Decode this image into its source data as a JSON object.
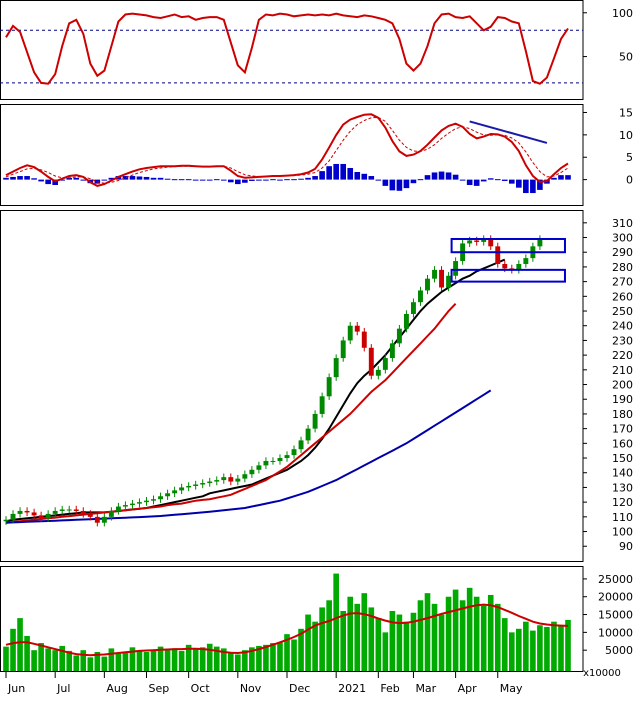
{
  "chart_data": [
    {
      "type": "line",
      "panel": "stochastic",
      "ylim": [
        5,
        110
      ],
      "yticks": [
        100,
        50
      ],
      "reference_lines": [
        80,
        20
      ],
      "colors": {
        "main": "#cc0000",
        "ref": "#000080"
      },
      "series": [
        {
          "values": [
            72,
            85,
            78,
            55,
            32,
            20,
            19,
            30,
            62,
            88,
            92,
            76,
            42,
            28,
            34,
            62,
            90,
            98,
            99,
            98,
            97,
            95,
            94,
            96,
            98,
            95,
            96,
            92,
            94,
            95,
            95,
            92,
            66,
            40,
            32,
            60,
            92,
            98,
            97,
            99,
            98,
            96,
            97,
            98,
            97,
            98,
            97,
            99,
            97,
            96,
            95,
            97,
            96,
            94,
            92,
            88,
            70,
            42,
            34,
            42,
            62,
            88,
            98,
            99,
            95,
            94,
            96,
            88,
            80,
            84,
            95,
            94,
            90,
            88,
            56,
            22,
            19,
            26,
            48,
            70,
            82
          ]
        }
      ]
    },
    {
      "type": "line",
      "panel": "macd",
      "ylim": [
        -5,
        16
      ],
      "yticks": [
        15,
        10,
        5,
        0
      ],
      "colors": {
        "macd": "#cc0000",
        "signal": "#cc0000",
        "hist": "#0000cc",
        "trend": "#1a1aaa"
      },
      "trendline": {
        "from": [
          66,
          13.0
        ],
        "to": [
          77,
          8.2
        ]
      },
      "series": [
        {
          "name": "macd",
          "values": [
            1,
            1.8,
            2.6,
            3.2,
            2.8,
            1.8,
            0.6,
            -0.4,
            0.2,
            0.8,
            1.0,
            0.6,
            -0.6,
            -1.4,
            -1.0,
            -0.2,
            0.6,
            1.2,
            1.8,
            2.3,
            2.6,
            2.8,
            3.0,
            3.0,
            3.0,
            3.1,
            3.1,
            3.0,
            2.9,
            2.9,
            3.0,
            3.0,
            2.0,
            0.8,
            0.4,
            0.5,
            0.6,
            0.7,
            0.8,
            0.8,
            0.9,
            1.0,
            1.2,
            1.6,
            2.4,
            4.5,
            7.2,
            10.0,
            12.3,
            13.4,
            14.0,
            14.5,
            14.6,
            13.8,
            11.6,
            8.6,
            6.3,
            5.3,
            5.6,
            6.4,
            7.8,
            9.4,
            11.0,
            12.0,
            12.5,
            11.8,
            10.2,
            9.2,
            9.6,
            10.2,
            10.1,
            9.6,
            8.4,
            6.4,
            3.2,
            0.8,
            -0.5,
            -0.3,
            1.2,
            2.6,
            3.6
          ]
        },
        {
          "name": "signal",
          "values": [
            0.6,
            1.2,
            1.8,
            2.4,
            2.5,
            2.2,
            1.6,
            0.8,
            0.4,
            0.4,
            0.6,
            0.6,
            0.2,
            -0.5,
            -0.8,
            -0.6,
            -0.2,
            0.4,
            1.0,
            1.6,
            2.0,
            2.4,
            2.6,
            2.8,
            2.9,
            3.0,
            3.0,
            3.0,
            3.0,
            2.9,
            2.9,
            3.0,
            2.6,
            1.8,
            1.1,
            0.8,
            0.7,
            0.7,
            0.7,
            0.8,
            0.8,
            0.9,
            1.0,
            1.2,
            1.6,
            2.6,
            4.2,
            6.5,
            8.8,
            10.8,
            12.3,
            13.2,
            13.8,
            13.9,
            13.0,
            11.0,
            8.8,
            7.2,
            6.4,
            6.3,
            6.8,
            7.8,
            9.2,
            10.4,
            11.4,
            11.8,
            11.4,
            10.6,
            10.0,
            9.9,
            10.0,
            9.9,
            9.3,
            8.2,
            6.2,
            3.8,
            1.8,
            0.6,
            0.8,
            1.6,
            2.6
          ]
        },
        {
          "name": "histogram",
          "values": [
            0.4,
            0.6,
            0.8,
            0.8,
            0.3,
            -0.4,
            -1.0,
            -1.2,
            -0.2,
            0.4,
            0.4,
            0.0,
            -0.8,
            -0.9,
            -0.2,
            0.4,
            0.8,
            0.8,
            0.8,
            0.7,
            0.6,
            0.4,
            0.4,
            0.2,
            0.1,
            0.1,
            0.1,
            0.0,
            -0.1,
            0.0,
            0.1,
            0.0,
            -0.6,
            -1.0,
            -0.7,
            -0.3,
            -0.1,
            0.0,
            0.1,
            0.0,
            0.1,
            0.1,
            0.2,
            0.4,
            0.8,
            1.9,
            3.0,
            3.5,
            3.5,
            2.6,
            1.7,
            1.3,
            0.8,
            -0.1,
            -1.4,
            -2.4,
            -2.5,
            -1.9,
            -0.8,
            0.1,
            1.0,
            1.6,
            1.8,
            1.6,
            1.1,
            0.0,
            -1.2,
            -1.4,
            -0.4,
            0.3,
            0.1,
            -0.3,
            -0.9,
            -1.8,
            -3.0,
            -3.0,
            -2.3,
            -0.9,
            0.4,
            1.0,
            1.0
          ]
        }
      ]
    },
    {
      "type": "candlestick",
      "panel": "price",
      "ylim": [
        82,
        316
      ],
      "yticks": [
        310,
        300,
        290,
        280,
        270,
        260,
        250,
        240,
        230,
        220,
        210,
        200,
        190,
        180,
        170,
        160,
        150,
        140,
        130,
        120,
        110,
        100,
        90
      ],
      "colors": {
        "up": "#008800",
        "down": "#cc0000",
        "ma_short": "#000000",
        "ma_mid": "#cc0000",
        "ma_long": "#0000aa",
        "box": "#0000cc"
      },
      "close": [
        108,
        112,
        114,
        113,
        111,
        109,
        112,
        114,
        115,
        115,
        114,
        112,
        110,
        106,
        110,
        114,
        117,
        118,
        119,
        120,
        121,
        122,
        124,
        126,
        128,
        130,
        131,
        132,
        133,
        134,
        135,
        137,
        134,
        136,
        139,
        142,
        145,
        148,
        148,
        150,
        152,
        156,
        162,
        170,
        180,
        192,
        205,
        218,
        230,
        240,
        236,
        225,
        206,
        210,
        218,
        228,
        238,
        248,
        256,
        264,
        272,
        278,
        266,
        274,
        284,
        296,
        298,
        297,
        299,
        294,
        282,
        279,
        278,
        282,
        286,
        294,
        299
      ]
    },
    {
      "type": "line",
      "panel": "price-ma",
      "series": [
        {
          "name": "ma_short",
          "values": [
            107,
            108,
            108.5,
            109,
            109.5,
            110,
            110.5,
            111,
            111.5,
            112,
            112.5,
            113,
            113,
            113,
            113,
            113.5,
            114,
            114.5,
            115,
            115.5,
            116,
            117,
            118,
            119,
            120,
            121,
            122,
            123,
            124,
            126,
            127,
            128,
            129,
            130,
            131,
            132,
            134,
            136,
            138,
            140,
            142,
            145,
            148,
            152,
            157,
            163,
            170,
            178,
            186,
            194,
            201,
            206,
            210,
            215,
            220,
            226,
            232,
            238,
            244,
            250,
            255,
            259,
            263,
            266,
            269,
            272,
            274,
            277,
            279,
            281,
            283,
            285
          ]
        },
        {
          "name": "ma_mid",
          "values": [
            106,
            106.5,
            107,
            107.5,
            108,
            108.5,
            109,
            109.5,
            110,
            110.5,
            111,
            111.5,
            112,
            112.5,
            113,
            113.5,
            114,
            114.5,
            115,
            115.5,
            116,
            116.5,
            117,
            118,
            118.5,
            119,
            120,
            121,
            121.5,
            122,
            123,
            124,
            125,
            127,
            129,
            131,
            133,
            135,
            138,
            141,
            144,
            148,
            152,
            156,
            160,
            164,
            168,
            172,
            176,
            180,
            185,
            190,
            195,
            199,
            203,
            208,
            213,
            218,
            223,
            228,
            233,
            238,
            244,
            250,
            255
          ]
        },
        {
          "name": "ma_long",
          "values": [
            106,
            106.2,
            106.4,
            106.6,
            106.8,
            107,
            107.2,
            107.4,
            107.6,
            107.8,
            108,
            108.2,
            108.4,
            108.6,
            108.8,
            109,
            109.2,
            109.4,
            109.6,
            109.8,
            110,
            110.3,
            110.6,
            111,
            111.4,
            111.8,
            112.2,
            112.6,
            113,
            113.5,
            114,
            114.5,
            115,
            115.5,
            116,
            117,
            118,
            119,
            120,
            121,
            122.5,
            124,
            125.5,
            127,
            129,
            131,
            133,
            135,
            137.5,
            140,
            142.5,
            145,
            147.5,
            150,
            152.5,
            155,
            157.5,
            160,
            163,
            166,
            169,
            172,
            175,
            178,
            181,
            184,
            187,
            190,
            193,
            196
          ]
        }
      ],
      "boxes": [
        {
          "from": [
            64,
            290
          ],
          "to": [
            79,
            299
          ]
        },
        {
          "from": [
            64,
            270
          ],
          "to": [
            79,
            278
          ]
        }
      ]
    },
    {
      "type": "bar",
      "panel": "volume",
      "ylim": [
        0,
        27500
      ],
      "yticks": [
        25000,
        20000,
        15000,
        10000,
        5000
      ],
      "unit_label": "x10000",
      "colors": {
        "bar": "#00aa00",
        "ma": "#cc0000"
      },
      "values": [
        6000,
        11000,
        14000,
        9000,
        5000,
        7000,
        5500,
        5000,
        6200,
        4800,
        3500,
        5000,
        3000,
        4500,
        3200,
        5500,
        4000,
        4200,
        5800,
        5000,
        4500,
        5200,
        6000,
        5000,
        5500,
        4800,
        6500,
        5200,
        5800,
        6800,
        6000,
        5500,
        4500,
        3800,
        5000,
        5800,
        6200,
        6500,
        7000,
        7200,
        9500,
        8000,
        11000,
        15000,
        13000,
        17000,
        19000,
        26500,
        16000,
        20000,
        18000,
        21000,
        17000,
        14000,
        10000,
        16000,
        15000,
        13000,
        15500,
        19000,
        21000,
        18000,
        15000,
        20000,
        22000,
        19000,
        22500,
        20000,
        17500,
        20500,
        18000,
        14000,
        10000,
        11000,
        13000,
        10500,
        12000,
        11500,
        13000,
        12000,
        13500
      ],
      "ma": [
        6500,
        7000,
        7200,
        7200,
        6800,
        6300,
        5800,
        5300,
        4800,
        4300,
        3900,
        3700,
        3600,
        3700,
        3800,
        4000,
        4200,
        4400,
        4600,
        4800,
        4900,
        5000,
        5100,
        5200,
        5300,
        5300,
        5400,
        5400,
        5300,
        5100,
        4800,
        4500,
        4300,
        4200,
        4400,
        4800,
        5300,
        5900,
        6500,
        7200,
        7900,
        8700,
        9600,
        10800,
        11900,
        12600,
        13200,
        14000,
        14700,
        15300,
        15400,
        15100,
        14600,
        13900,
        13300,
        12800,
        12600,
        12700,
        13000,
        13500,
        14000,
        14600,
        15200,
        15700,
        16200,
        16700,
        17200,
        17600,
        17800,
        17600,
        17100,
        16300,
        15500,
        14600,
        13800,
        13000,
        12500,
        12200,
        12000,
        11900,
        11800
      ]
    }
  ],
  "x_axis": {
    "labels": [
      "Jun",
      "Jul",
      "Aug",
      "Sep",
      "Oct",
      "Nov",
      "Dec",
      "2021",
      "Feb",
      "Mar",
      "Apr",
      "May"
    ],
    "label_index": [
      0,
      7,
      14,
      20,
      26,
      33,
      40,
      47,
      53,
      58,
      64,
      70
    ]
  }
}
